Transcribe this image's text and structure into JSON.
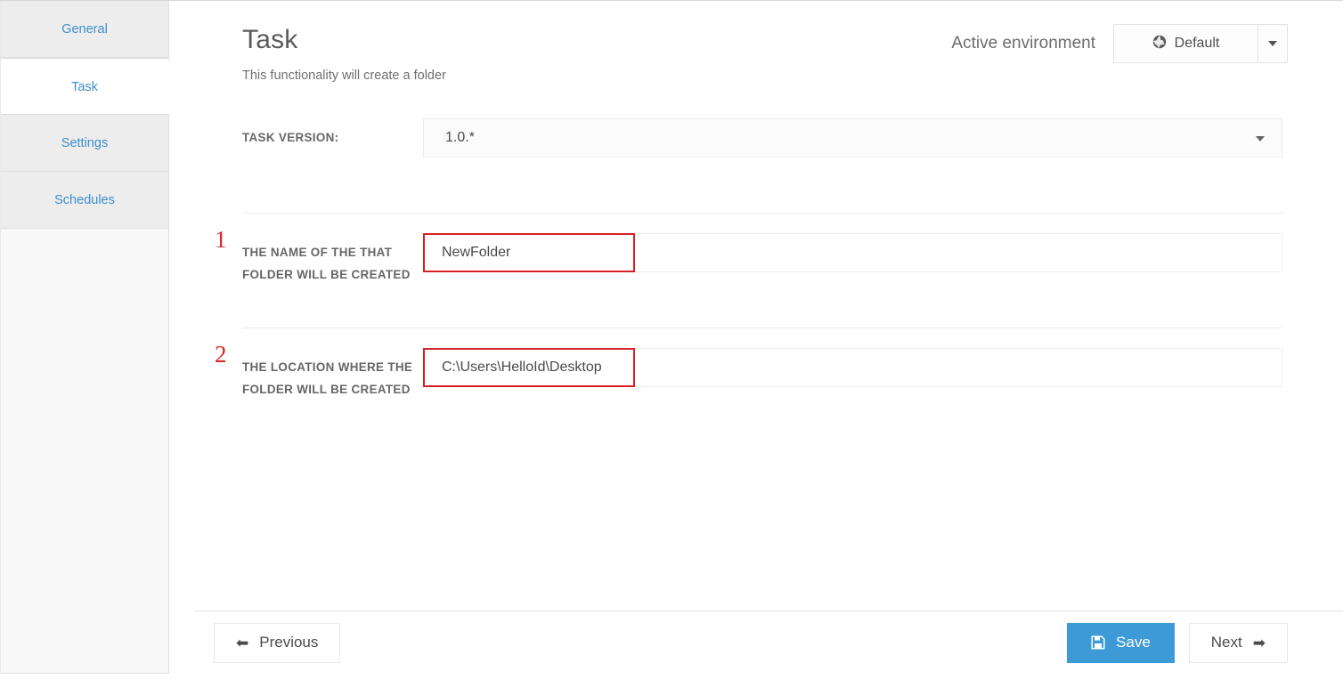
{
  "sidebar": {
    "tabs": [
      {
        "label": "General",
        "active": false
      },
      {
        "label": "Task",
        "active": true
      },
      {
        "label": "Settings",
        "active": false
      },
      {
        "label": "Schedules",
        "active": false
      }
    ]
  },
  "header": {
    "title": "Task",
    "subtitle": "This functionality will create a folder",
    "environment_label": "Active environment",
    "environment_value": "Default",
    "environment_icon": "globe-icon",
    "caret_icon": "chevron-down-icon"
  },
  "form": {
    "version": {
      "label": "TASK VERSION:",
      "value": "1.0.*"
    },
    "fields": [
      {
        "number": "1",
        "label": "THE NAME OF THE THAT FOLDER WILL BE CREATED",
        "value": "NewFolder",
        "placeholder": "",
        "highlighted": true
      },
      {
        "number": "2",
        "label": "THE LOCATION WHERE THE FOLDER WILL BE CREATED",
        "value": "C:\\Users\\HelloId\\Desktop",
        "placeholder": "",
        "highlighted": true
      }
    ]
  },
  "footer": {
    "previous_label": "Previous",
    "previous_icon": "arrow-left-icon",
    "save_label": "Save",
    "save_icon": "floppy-disk-icon",
    "next_label": "Next",
    "next_icon": "arrow-right-icon"
  },
  "colors": {
    "accent_blue": "#3d9ad6",
    "tab_link": "#3d8ecb",
    "annotation_red": "#d81f26",
    "label_gray": "#666666"
  }
}
